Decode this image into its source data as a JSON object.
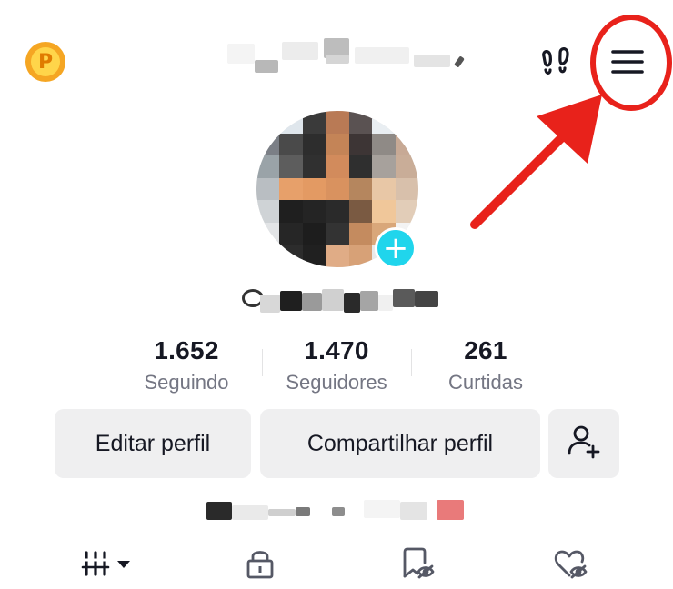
{
  "header": {
    "coin_icon": "coin-icon",
    "coin_letter": "P",
    "footprint_icon": "footprints-icon",
    "menu_icon": "hamburger-menu-icon"
  },
  "profile": {
    "avatar_add_symbol": "+"
  },
  "stats": [
    {
      "value": "1.652",
      "label": "Seguindo"
    },
    {
      "value": "1.470",
      "label": "Seguidores"
    },
    {
      "value": "261",
      "label": "Curtidas"
    }
  ],
  "buttons": {
    "edit_profile": "Editar perfil",
    "share_profile": "Compartilhar perfil",
    "add_friend_icon": "add-friend-icon"
  },
  "tabs": [
    {
      "icon": "grid-videos-icon"
    },
    {
      "icon": "lock-private-icon"
    },
    {
      "icon": "bookmark-hidden-icon"
    },
    {
      "icon": "heart-hidden-icon"
    }
  ],
  "colors": {
    "accent_cyan": "#20d5ec",
    "annotation_red": "#e8221b",
    "button_bg": "#efeff0",
    "secondary_text": "#747683"
  }
}
